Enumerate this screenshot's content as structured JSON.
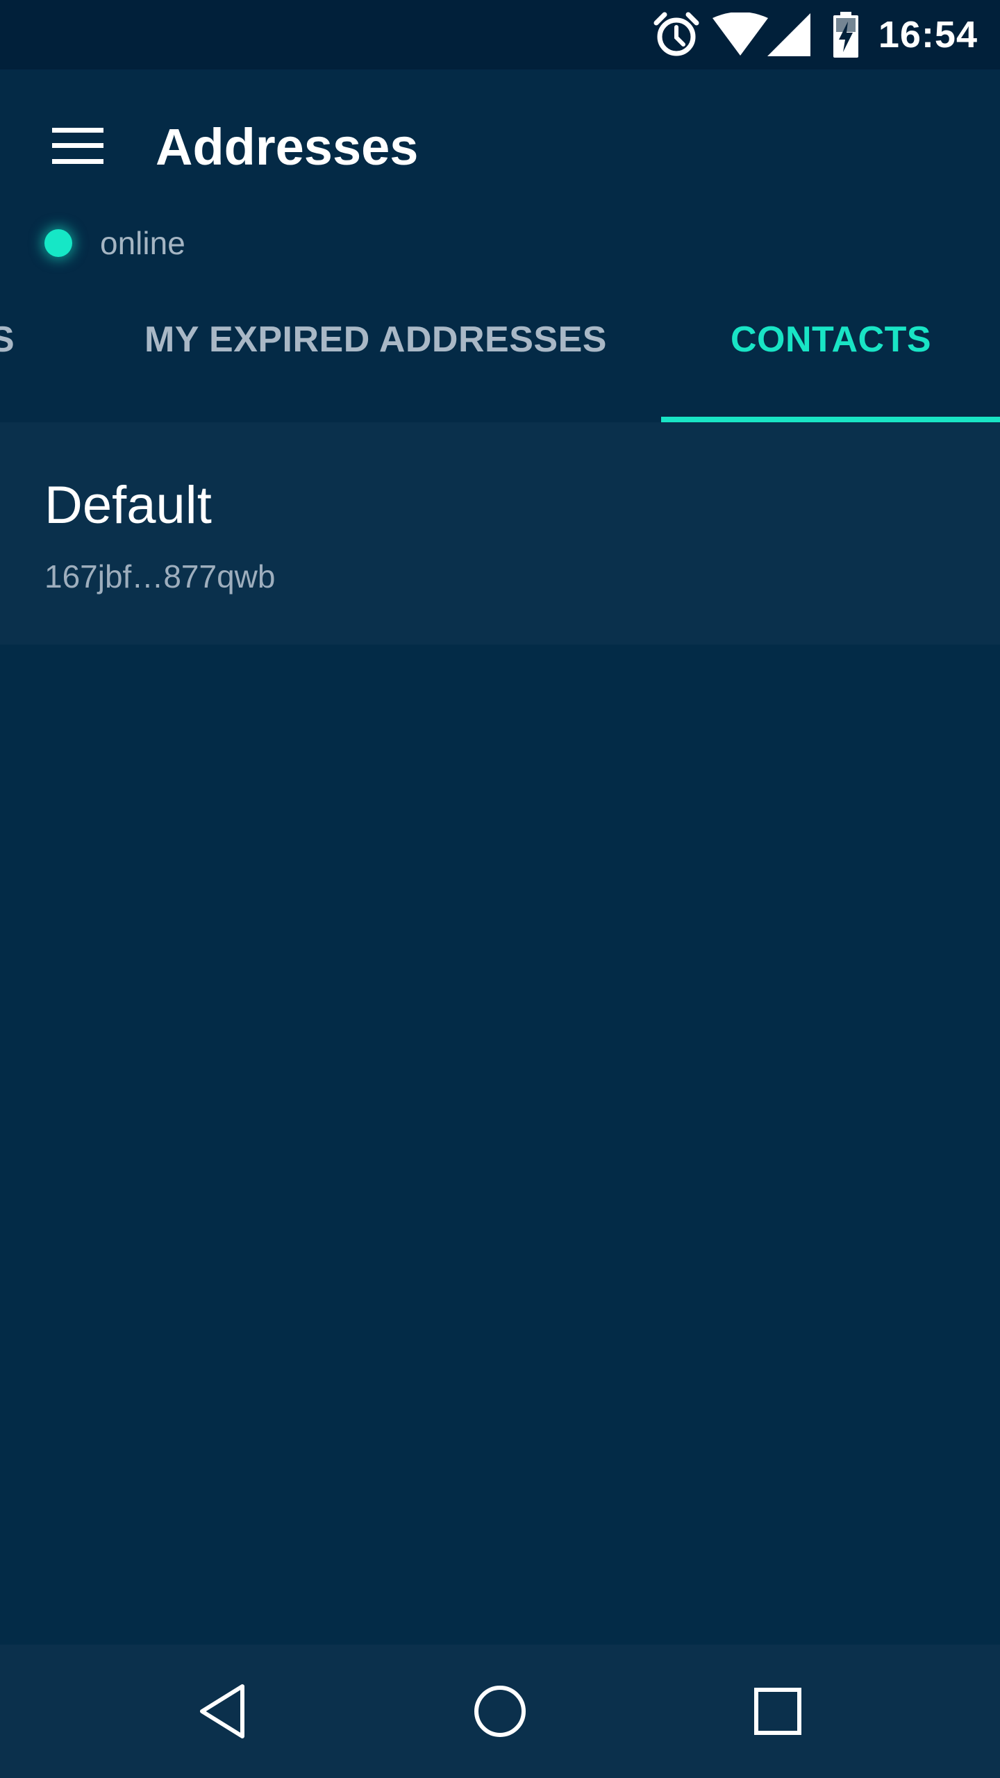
{
  "status_bar": {
    "time": "16:54",
    "icons": [
      "alarm-icon",
      "wifi-icon",
      "cell-signal-icon",
      "battery-charging-icon"
    ]
  },
  "app_bar": {
    "title": "Addresses",
    "menu_icon": "menu-icon",
    "connection_status": "online"
  },
  "tabs": [
    {
      "label": "S",
      "selected": false
    },
    {
      "label": "MY EXPIRED ADDRESSES",
      "selected": false
    },
    {
      "label": "CONTACTS",
      "selected": true
    }
  ],
  "contacts": [
    {
      "name": "Default",
      "address": "167jbf…877qwb"
    }
  ],
  "nav_bar": {
    "icons": [
      "back-icon",
      "home-icon",
      "recents-icon"
    ]
  },
  "colors": {
    "background": "#032b47",
    "status_bar": "#01203a",
    "accent": "#19e4c5",
    "list_item": "#0a304c",
    "nav_bar": "#0b304c"
  }
}
